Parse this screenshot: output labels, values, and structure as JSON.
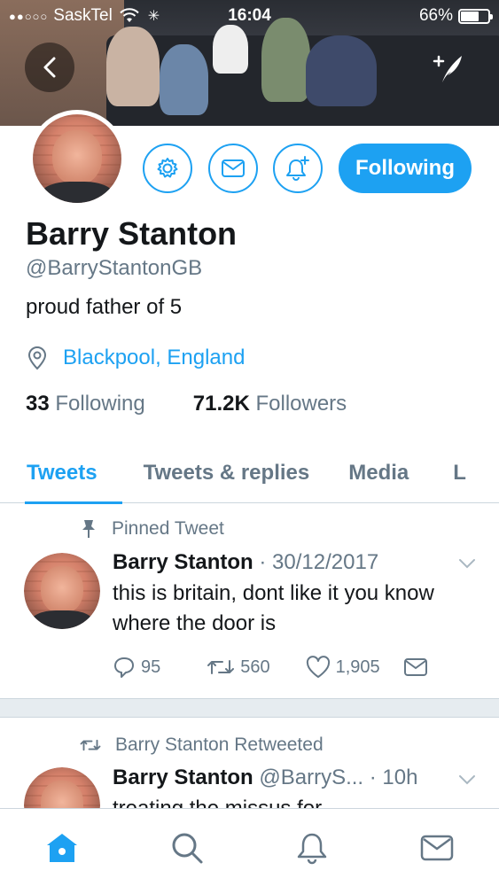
{
  "status_bar": {
    "signal_dots": "●●○○○",
    "carrier": "SaskTel",
    "time": "16:04",
    "battery": "66%",
    "battery_level": 0.66
  },
  "header": {
    "back_icon": "chevron-left-icon",
    "compose_icon": "compose-tweet-icon"
  },
  "profile": {
    "name": "Barry Stanton",
    "handle": "@BarryStantonGB",
    "bio": "proud father of 5",
    "location": "Blackpool, England",
    "following_count": "33",
    "following_label": "Following",
    "followers_count": "71.2K",
    "followers_label": "Followers",
    "follow_button": "Following"
  },
  "tabs": [
    {
      "label": "Tweets",
      "active": true
    },
    {
      "label": "Tweets & replies",
      "active": false
    },
    {
      "label": "Media",
      "active": false
    },
    {
      "label": "L",
      "active": false
    }
  ],
  "pinned_tweet": {
    "label": "Pinned Tweet",
    "author": "Barry Stanton",
    "separator": "·",
    "date": "30/12/2017",
    "text": "this is britain, dont like it you know where the door is",
    "replies": "95",
    "retweets": "560",
    "likes": "1,905"
  },
  "retweet": {
    "label": "Barry Stanton Retweeted",
    "author": "Barry Stanton",
    "handle": "@BarryS...",
    "time": "· 10h",
    "text": "treating the missus for"
  },
  "colors": {
    "accent": "#1da1f2",
    "muted": "#657786",
    "text": "#14171a"
  }
}
